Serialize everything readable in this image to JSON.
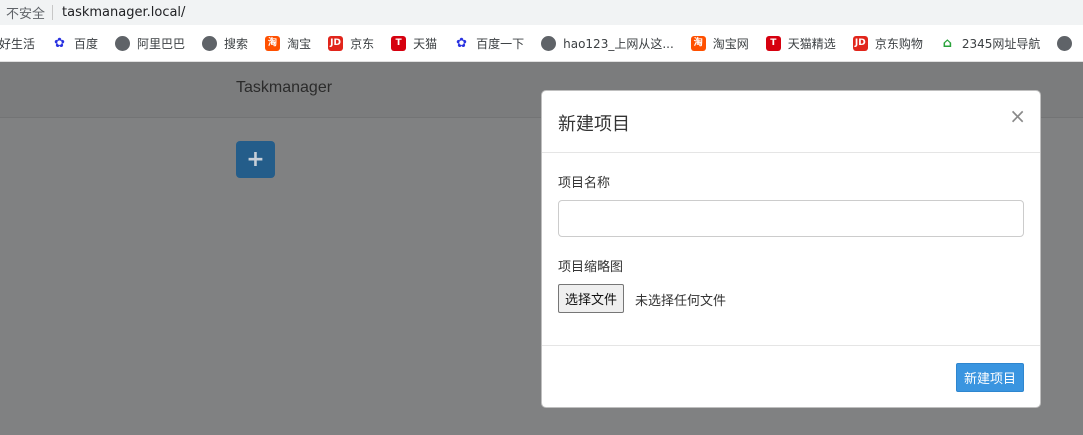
{
  "browser": {
    "security_label": "不安全",
    "url": "taskmanager.local/",
    "bookmarks": [
      {
        "label": "好生活",
        "icon": "none"
      },
      {
        "label": "百度",
        "icon": "baidu-icon"
      },
      {
        "label": "阿里巴巴",
        "icon": "globe-icon"
      },
      {
        "label": "搜索",
        "icon": "globe-icon"
      },
      {
        "label": "淘宝",
        "icon": "taobao-icon"
      },
      {
        "label": "京东",
        "icon": "jd-icon"
      },
      {
        "label": "天猫",
        "icon": "tmall-icon"
      },
      {
        "label": "百度一下",
        "icon": "baidu-icon"
      },
      {
        "label": "hao123_上网从这...",
        "icon": "globe-icon"
      },
      {
        "label": "淘宝网",
        "icon": "taobao-icon"
      },
      {
        "label": "天猫精选",
        "icon": "tmall-icon"
      },
      {
        "label": "京东购物",
        "icon": "jd-icon"
      },
      {
        "label": "2345网址导航",
        "icon": "2345-icon"
      }
    ]
  },
  "navbar": {
    "brand": "Taskmanager"
  },
  "toolbar": {
    "add_symbol": "+"
  },
  "modal": {
    "title": "新建项目",
    "close_symbol": "×",
    "name_label": "项目名称",
    "name_value": "",
    "thumbnail_label": "项目缩略图",
    "file_button_label": "选择文件",
    "file_status": "未选择任何文件",
    "submit_label": "新建项目"
  },
  "colors": {
    "primary": "#3a95e0",
    "backdrop": "#808182"
  }
}
